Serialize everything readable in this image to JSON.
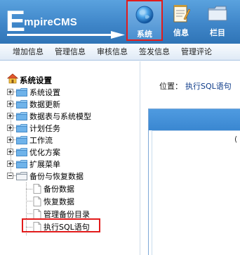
{
  "header": {
    "logo_e": "E",
    "logo_rest": "mpireCMS",
    "nav": [
      {
        "label": "系统",
        "icon": "globe-icon",
        "active": true
      },
      {
        "label": "信息",
        "icon": "notepad-icon",
        "active": false
      },
      {
        "label": "栏目",
        "icon": "folder-icon",
        "active": false
      }
    ]
  },
  "menubar": {
    "items": [
      "增加信息",
      "管理信息",
      "审核信息",
      "签发信息",
      "管理评论"
    ]
  },
  "sidebar": {
    "title": "系统设置",
    "items": [
      {
        "label": "系统设置",
        "expanded": false
      },
      {
        "label": "数据更新",
        "expanded": false
      },
      {
        "label": "数据表与系统模型",
        "expanded": false
      },
      {
        "label": "计划任务",
        "expanded": false
      },
      {
        "label": "工作流",
        "expanded": false
      },
      {
        "label": "优化方案",
        "expanded": false
      },
      {
        "label": "扩展菜单",
        "expanded": false
      },
      {
        "label": "备份与恢复数据",
        "expanded": true
      }
    ],
    "children": [
      "备份数据",
      "恢复数据",
      "管理备份目录",
      "执行SQL语句"
    ],
    "selected": "执行SQL语句"
  },
  "content": {
    "position_label": "位置：",
    "position_link": "执行SQL语句",
    "panel_text": "("
  },
  "colors": {
    "header_blue": "#3f86c9",
    "highlight_red": "#e21b1b",
    "link_blue": "#0f3c8a"
  }
}
